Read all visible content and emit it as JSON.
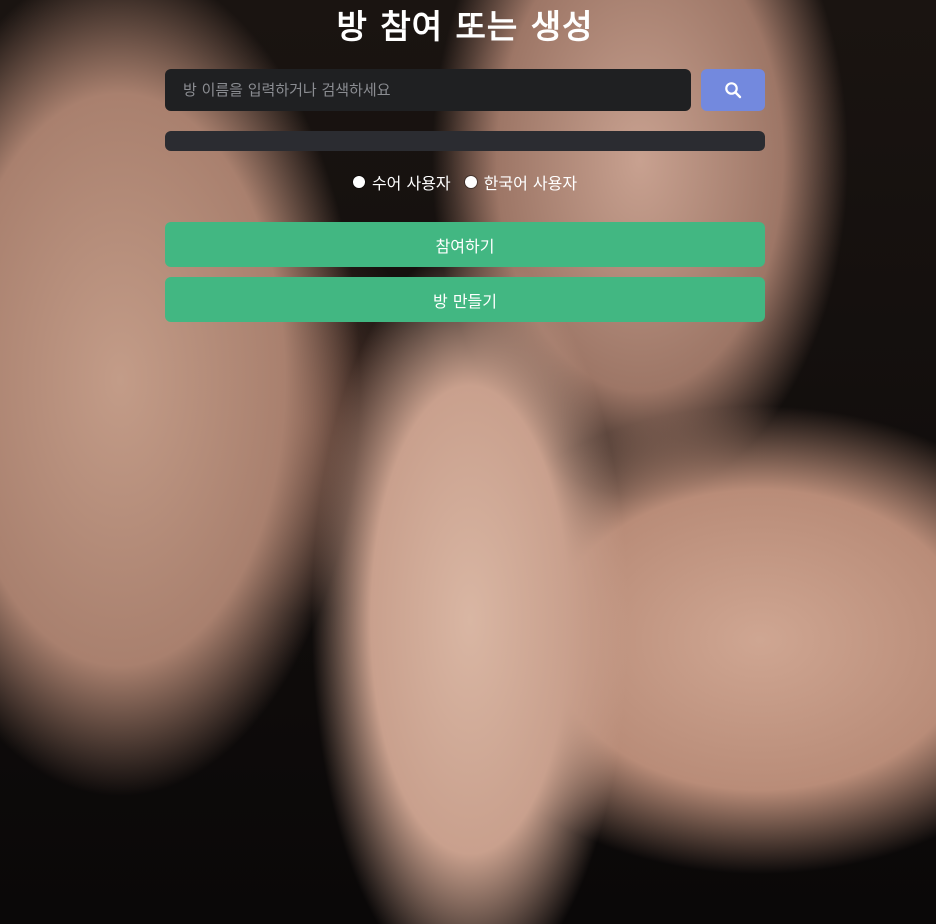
{
  "title": "방 참여 또는 생성",
  "search": {
    "placeholder": "방 이름을 입력하거나 검색하세요",
    "value": "",
    "button_icon": "search-icon",
    "button_color": "#7389de"
  },
  "user_type": {
    "options": [
      {
        "label": "수어 사용자"
      },
      {
        "label": "한국어 사용자"
      }
    ]
  },
  "actions": {
    "join_label": "참여하기",
    "create_label": "방 만들기",
    "button_color": "#42b782"
  },
  "colors": {
    "input_bg": "#1f2022",
    "list_bg": "#2b2c31"
  }
}
